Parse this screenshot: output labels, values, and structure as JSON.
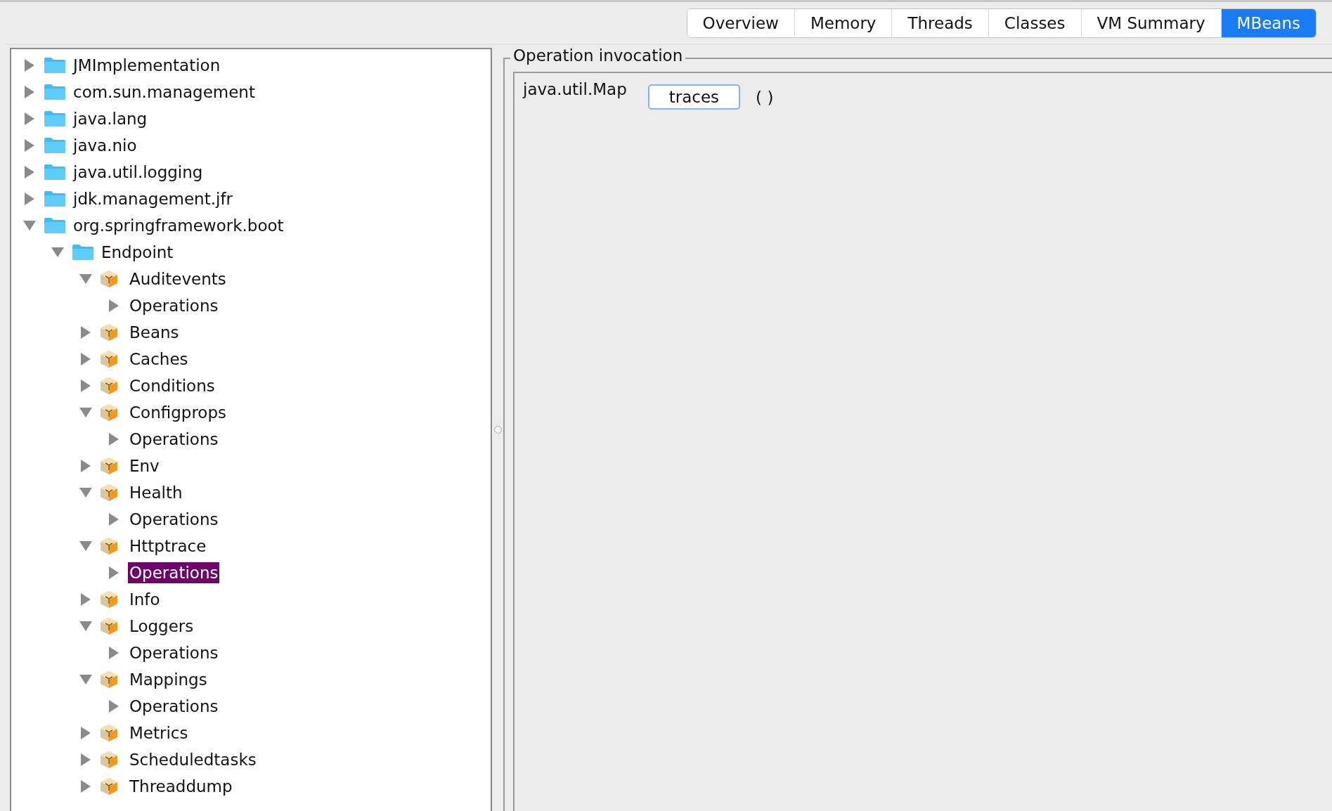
{
  "tabs": [
    {
      "label": "Overview",
      "selected": false
    },
    {
      "label": "Memory",
      "selected": false
    },
    {
      "label": "Threads",
      "selected": false
    },
    {
      "label": "Classes",
      "selected": false
    },
    {
      "label": "VM Summary",
      "selected": false
    },
    {
      "label": "MBeans",
      "selected": true
    }
  ],
  "tree": [
    {
      "label": "JMImplementation",
      "kind": "folder",
      "expanded": false,
      "selected": false
    },
    {
      "label": "com.sun.management",
      "kind": "folder",
      "expanded": false,
      "selected": false
    },
    {
      "label": "java.lang",
      "kind": "folder",
      "expanded": false,
      "selected": false
    },
    {
      "label": "java.nio",
      "kind": "folder",
      "expanded": false,
      "selected": false
    },
    {
      "label": "java.util.logging",
      "kind": "folder",
      "expanded": false,
      "selected": false
    },
    {
      "label": "jdk.management.jfr",
      "kind": "folder",
      "expanded": false,
      "selected": false
    },
    {
      "label": "org.springframework.boot",
      "kind": "folder",
      "expanded": true,
      "selected": false,
      "children": [
        {
          "label": "Endpoint",
          "kind": "folder",
          "expanded": true,
          "selected": false,
          "children": [
            {
              "label": "Auditevents",
              "kind": "mbean",
              "expanded": true,
              "selected": false,
              "children": [
                {
                  "label": "Operations",
                  "expanded": false,
                  "selected": false
                }
              ]
            },
            {
              "label": "Beans",
              "kind": "mbean",
              "expanded": false,
              "selected": false
            },
            {
              "label": "Caches",
              "kind": "mbean",
              "expanded": false,
              "selected": false
            },
            {
              "label": "Conditions",
              "kind": "mbean",
              "expanded": false,
              "selected": false
            },
            {
              "label": "Configprops",
              "kind": "mbean",
              "expanded": true,
              "selected": false,
              "children": [
                {
                  "label": "Operations",
                  "expanded": false,
                  "selected": false
                }
              ]
            },
            {
              "label": "Env",
              "kind": "mbean",
              "expanded": false,
              "selected": false
            },
            {
              "label": "Health",
              "kind": "mbean",
              "expanded": true,
              "selected": false,
              "children": [
                {
                  "label": "Operations",
                  "expanded": false,
                  "selected": false
                }
              ]
            },
            {
              "label": "Httptrace",
              "kind": "mbean",
              "expanded": true,
              "selected": false,
              "children": [
                {
                  "label": "Operations",
                  "expanded": false,
                  "selected": true
                }
              ]
            },
            {
              "label": "Info",
              "kind": "mbean",
              "expanded": false,
              "selected": false
            },
            {
              "label": "Loggers",
              "kind": "mbean",
              "expanded": true,
              "selected": false,
              "children": [
                {
                  "label": "Operations",
                  "expanded": false,
                  "selected": false
                }
              ]
            },
            {
              "label": "Mappings",
              "kind": "mbean",
              "expanded": true,
              "selected": false,
              "children": [
                {
                  "label": "Operations",
                  "expanded": false,
                  "selected": false
                }
              ]
            },
            {
              "label": "Metrics",
              "kind": "mbean",
              "expanded": false,
              "selected": false
            },
            {
              "label": "Scheduledtasks",
              "kind": "mbean",
              "expanded": false,
              "selected": false
            },
            {
              "label": "Threaddump",
              "kind": "mbean",
              "expanded": false,
              "selected": false
            }
          ]
        }
      ]
    }
  ],
  "operation_invocation": {
    "title": "Operation invocation",
    "return_type": "java.util.Map",
    "button": "traces",
    "params": "( )"
  }
}
